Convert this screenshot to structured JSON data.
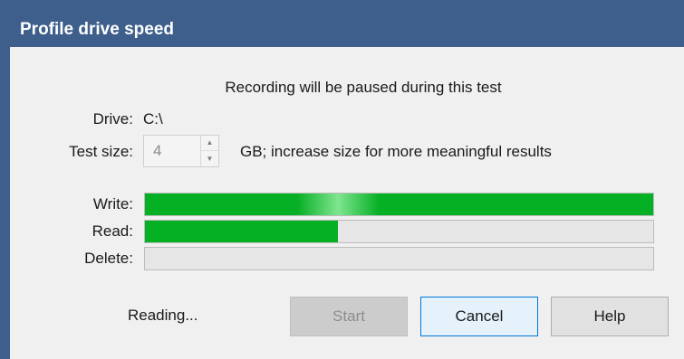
{
  "window": {
    "title": "Profile drive speed"
  },
  "dialog": {
    "notice": "Recording will be paused during this test",
    "drive_label": "Drive:",
    "drive_value": "C:\\",
    "test_size_label": "Test size:",
    "test_size_value": "4",
    "test_size_hint": "GB; increase size for more meaningful results",
    "progress": [
      {
        "label": "Write:",
        "fraction": 1.0
      },
      {
        "label": "Read:",
        "fraction": 0.38
      },
      {
        "label": "Delete:",
        "fraction": 0.0
      }
    ],
    "status": "Reading...",
    "buttons": {
      "start": "Start",
      "cancel": "Cancel",
      "help": "Help"
    }
  },
  "colors": {
    "titlebar": "#3e5f8c",
    "progress_fill": "#06b025",
    "default_button_border": "#0078d7"
  },
  "icons": {
    "spin_up": "chevron-up-icon",
    "spin_down": "chevron-down-icon"
  }
}
